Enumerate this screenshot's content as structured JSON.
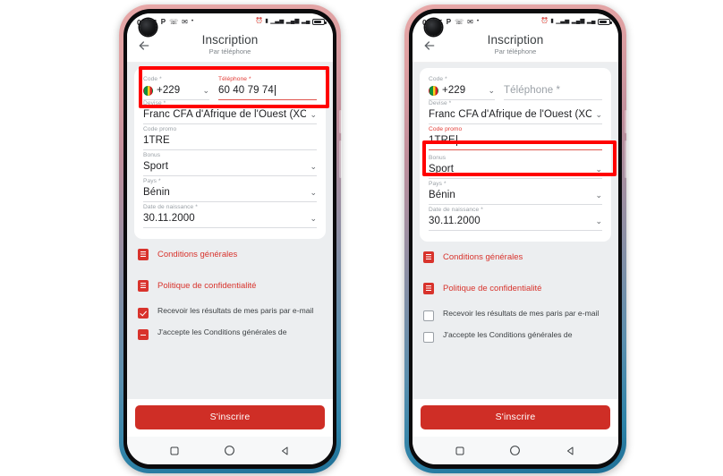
{
  "phones": [
    {
      "id": "left",
      "status_bar": {
        "time": "07:26",
        "icons_left": [
          "P",
          "whatsapp-icon",
          "mail-icon",
          "dot-icon"
        ],
        "icons_right": [
          "alarm-icon",
          "vibrate-icon",
          "signal-bars-icon",
          "signal-4g-icon",
          "signal-2-icon",
          "battery-icon"
        ]
      },
      "header": {
        "title": "Inscription",
        "subtitle": "Par téléphone",
        "back": "←"
      },
      "form": {
        "code": {
          "label": "Code *",
          "value": "+229",
          "flag": "benin-flag-icon",
          "chevron": "⌄"
        },
        "phone": {
          "label": "Téléphone *",
          "value": "60 40 79 74",
          "placeholder": "Téléphone *",
          "focused": true
        },
        "devise": {
          "label": "Devise *",
          "value": "Franc CFA d'Afrique de l'Ouest (XOF)",
          "chevron": "⌄"
        },
        "promo": {
          "label": "Code promo",
          "value": "1TRE",
          "focused": false
        },
        "bonus": {
          "label": "Bonus",
          "value": "Sport",
          "chevron": "⌄"
        },
        "pays": {
          "label": "Pays *",
          "value": "Bénin",
          "chevron": "⌄"
        },
        "birthdate": {
          "label": "Date de naissance *",
          "value": "30.11.2000",
          "chevron": "⌄"
        }
      },
      "links": [
        {
          "icon": "document-icon",
          "label": "Conditions générales"
        },
        {
          "icon": "document-icon",
          "label": "Politique de confidentialité"
        }
      ],
      "checkboxes": [
        {
          "label": "Recevoir les résultats de mes paris par e-mail",
          "state": "checked"
        },
        {
          "label": "J'accepte les Conditions générales de",
          "state": "indeterminate"
        }
      ],
      "cta": "S'inscrire",
      "nav": [
        "square-icon",
        "circle-icon",
        "back-triangle-icon"
      ],
      "annotation": "phone-field-highlight"
    },
    {
      "id": "right",
      "status_bar": {
        "time": "07:25",
        "icons_left": [
          "P",
          "whatsapp-icon",
          "mail-icon",
          "dot-icon"
        ],
        "icons_right": [
          "alarm-icon",
          "vibrate-icon",
          "signal-bars-icon",
          "signal-4g-icon",
          "signal-2-icon",
          "battery-icon"
        ]
      },
      "header": {
        "title": "Inscription",
        "subtitle": "Par téléphone",
        "back": "←"
      },
      "form": {
        "code": {
          "label": "Code *",
          "value": "+229",
          "flag": "benin-flag-icon",
          "chevron": "⌄"
        },
        "phone": {
          "label": "",
          "value": "",
          "placeholder": "Téléphone *",
          "focused": false
        },
        "devise": {
          "label": "Devise *",
          "value": "Franc CFA d'Afrique de l'Ouest (XOF)",
          "chevron": "⌄"
        },
        "promo": {
          "label": "Code promo",
          "value": "1TRE",
          "focused": true
        },
        "bonus": {
          "label": "Bonus",
          "value": "Sport",
          "chevron": "⌄"
        },
        "pays": {
          "label": "Pays *",
          "value": "Bénin",
          "chevron": "⌄"
        },
        "birthdate": {
          "label": "Date de naissance *",
          "value": "30.11.2000",
          "chevron": "⌄"
        }
      },
      "links": [
        {
          "icon": "document-icon",
          "label": "Conditions générales"
        },
        {
          "icon": "document-icon",
          "label": "Politique de confidentialité"
        }
      ],
      "checkboxes": [
        {
          "label": "Recevoir les résultats de mes paris par e-mail",
          "state": "unchecked"
        },
        {
          "label": "J'accepte les Conditions générales de",
          "state": "unchecked"
        }
      ],
      "cta": "S'inscrire",
      "nav": [
        "square-icon",
        "circle-icon",
        "back-triangle-icon"
      ],
      "annotation": "promo-field-highlight"
    }
  ],
  "colors": {
    "brand_red": "#d8332c",
    "cta_red": "#cf2e26",
    "annotation_red": "#ff0000",
    "label_grey": "#9aa0a6",
    "text_dark": "#202124",
    "screen_bg": "#eceef0",
    "frame_top": "#e8a8a8",
    "frame_bottom": "#1f6f96"
  }
}
